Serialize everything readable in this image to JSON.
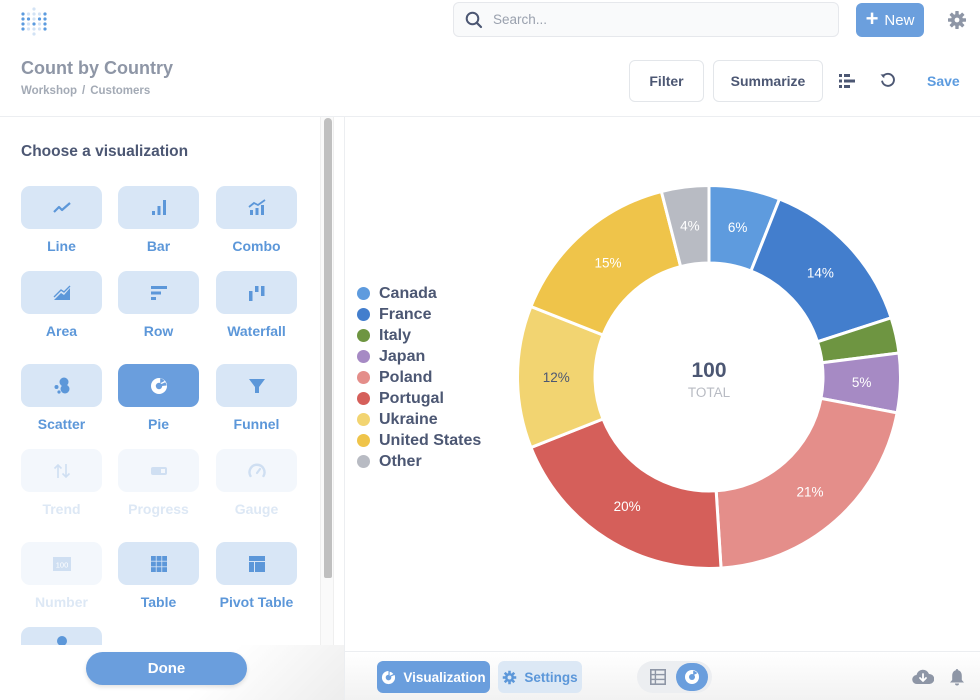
{
  "nav": {
    "search_placeholder": "Search...",
    "new_label": "New"
  },
  "header": {
    "title": "Count by Country",
    "breadcrumb": [
      "Workshop",
      "Customers"
    ],
    "breadcrumb_separator": "/",
    "filter_label": "Filter",
    "summarize_label": "Summarize",
    "save_label": "Save"
  },
  "sidebar": {
    "title": "Choose a visualization",
    "tiles": [
      {
        "label": "Line",
        "icon": "line-icon",
        "state": "enabled"
      },
      {
        "label": "Bar",
        "icon": "bar-icon",
        "state": "enabled"
      },
      {
        "label": "Combo",
        "icon": "combo-icon",
        "state": "enabled"
      },
      {
        "label": "Area",
        "icon": "area-icon",
        "state": "enabled"
      },
      {
        "label": "Row",
        "icon": "row-icon",
        "state": "enabled"
      },
      {
        "label": "Waterfall",
        "icon": "waterfall-icon",
        "state": "enabled"
      },
      {
        "label": "Scatter",
        "icon": "scatter-icon",
        "state": "enabled"
      },
      {
        "label": "Pie",
        "icon": "pie-icon",
        "state": "selected"
      },
      {
        "label": "Funnel",
        "icon": "funnel-icon",
        "state": "enabled"
      },
      {
        "label": "Trend",
        "icon": "trend-icon",
        "state": "disabled"
      },
      {
        "label": "Progress",
        "icon": "progress-icon",
        "state": "disabled"
      },
      {
        "label": "Gauge",
        "icon": "gauge-icon",
        "state": "disabled"
      },
      {
        "label": "Number",
        "icon": "number-icon",
        "state": "disabled",
        "icon_text": "100"
      },
      {
        "label": "Table",
        "icon": "table-icon",
        "state": "enabled"
      },
      {
        "label": "Pivot Table",
        "icon": "pivot-table-icon",
        "state": "enabled"
      },
      {
        "label": "",
        "icon": "map-pin-icon",
        "state": "enabled"
      }
    ],
    "done_label": "Done"
  },
  "footer": {
    "visualization_label": "Visualization",
    "settings_label": "Settings"
  },
  "chart_data": {
    "type": "pie",
    "variant": "donut",
    "title": "Count by Country",
    "categories": [
      "Canada",
      "France",
      "Italy",
      "Japan",
      "Poland",
      "Portugal",
      "Ukraine",
      "United States",
      "Other"
    ],
    "values": [
      6,
      14,
      3,
      5,
      21,
      20,
      12,
      15,
      4
    ],
    "percent_labels": [
      "6%",
      "14%",
      "",
      "5%",
      "21%",
      "20%",
      "12%",
      "15%",
      "4%"
    ],
    "colors": [
      "#5E9BDE",
      "#437ECD",
      "#6E9541",
      "#A68AC4",
      "#E48E8A",
      "#D55F5A",
      "#F2D471",
      "#EFC44A",
      "#B8BBC3"
    ],
    "label_colors": [
      "#FFFFFF",
      "#FFFFFF",
      "#FFFFFF",
      "#FFFFFF",
      "#FFFFFF",
      "#FFFFFF",
      "#4C5773",
      "#FFFFFF",
      "#FFFFFF"
    ],
    "total_value": "100",
    "total_label": "TOTAL",
    "legend_position": "left"
  }
}
